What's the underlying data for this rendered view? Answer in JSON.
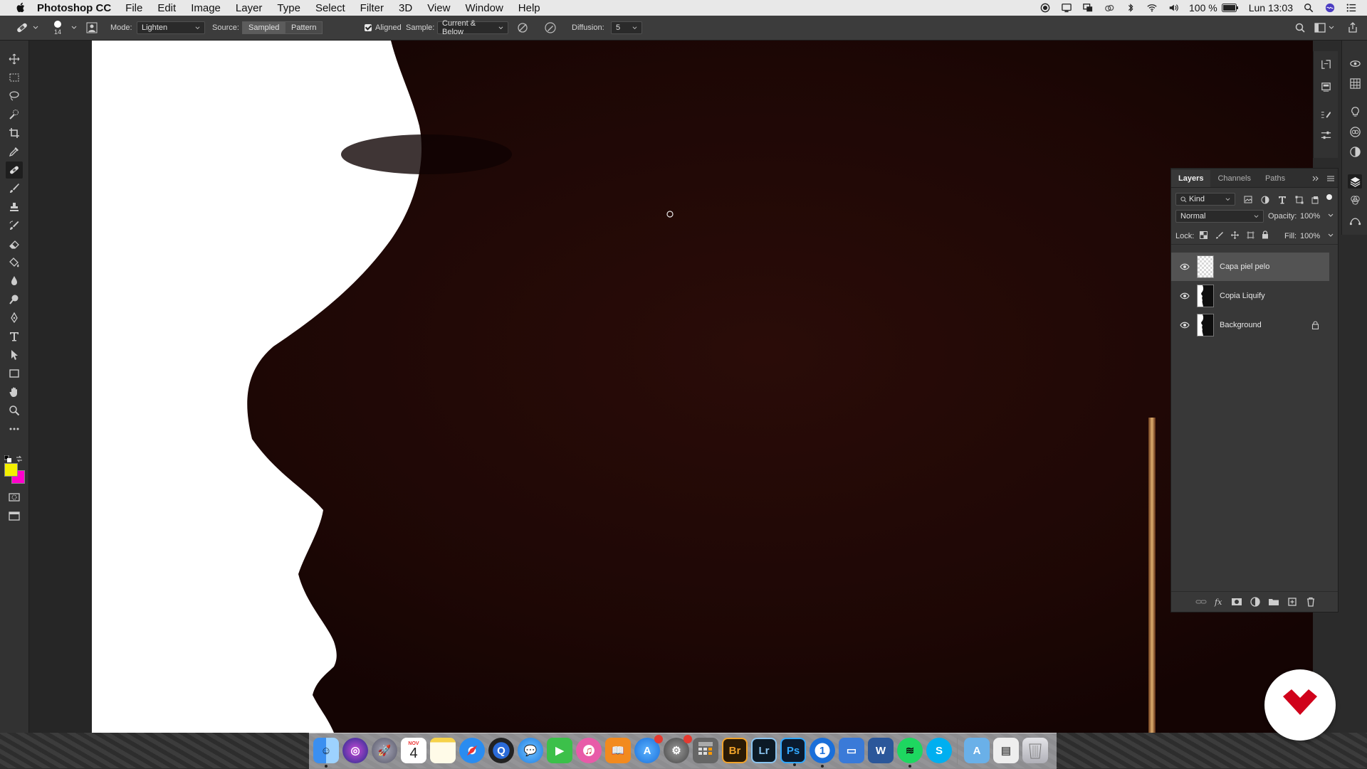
{
  "menubar": {
    "app_name": "Photoshop CC",
    "items": [
      "File",
      "Edit",
      "Image",
      "Layer",
      "Type",
      "Select",
      "Filter",
      "3D",
      "View",
      "Window",
      "Help"
    ],
    "battery": "100 %",
    "clock": "Lun 13:03"
  },
  "options": {
    "brush_size": "14",
    "mode_label": "Mode:",
    "mode_value": "Lighten",
    "source_label": "Source:",
    "source_sampled": "Sampled",
    "source_pattern": "Pattern",
    "aligned_label": "Aligned",
    "sample_label": "Sample:",
    "sample_value": "Current & Below",
    "diffusion_label": "Diffusion:",
    "diffusion_value": "5"
  },
  "colors": {
    "foreground": "#f4f000",
    "background": "#ff00cc",
    "canvas_dark": "#1a0705",
    "panel": "#383838",
    "selected_layer": "#535353"
  },
  "layers_panel": {
    "tabs": [
      "Layers",
      "Channels",
      "Paths"
    ],
    "filter_kind": "Kind",
    "blend_mode": "Normal",
    "opacity_label": "Opacity:",
    "opacity_value": "100%",
    "lock_label": "Lock:",
    "fill_label": "Fill:",
    "fill_value": "100%",
    "layers": [
      {
        "name": "Capa piel pelo",
        "selected": true,
        "locked": false
      },
      {
        "name": "Copia Liquify",
        "selected": false,
        "locked": false
      },
      {
        "name": "Background",
        "selected": false,
        "locked": true
      }
    ]
  },
  "dock": {
    "calendar_month": "NOV",
    "calendar_day": "4",
    "apps": [
      "Finder",
      "Siri",
      "Launchpad",
      "Calendar",
      "Notes",
      "Safari",
      "QuickTime",
      "Messages",
      "FaceTime",
      "iTunes",
      "iBooks",
      "App Store",
      "System Preferences",
      "Calculator",
      "Br",
      "Lr",
      "Ps",
      "1Password",
      "Keynote",
      "W",
      "Spotify",
      "S",
      "Applications",
      "Documents",
      "Trash"
    ]
  }
}
